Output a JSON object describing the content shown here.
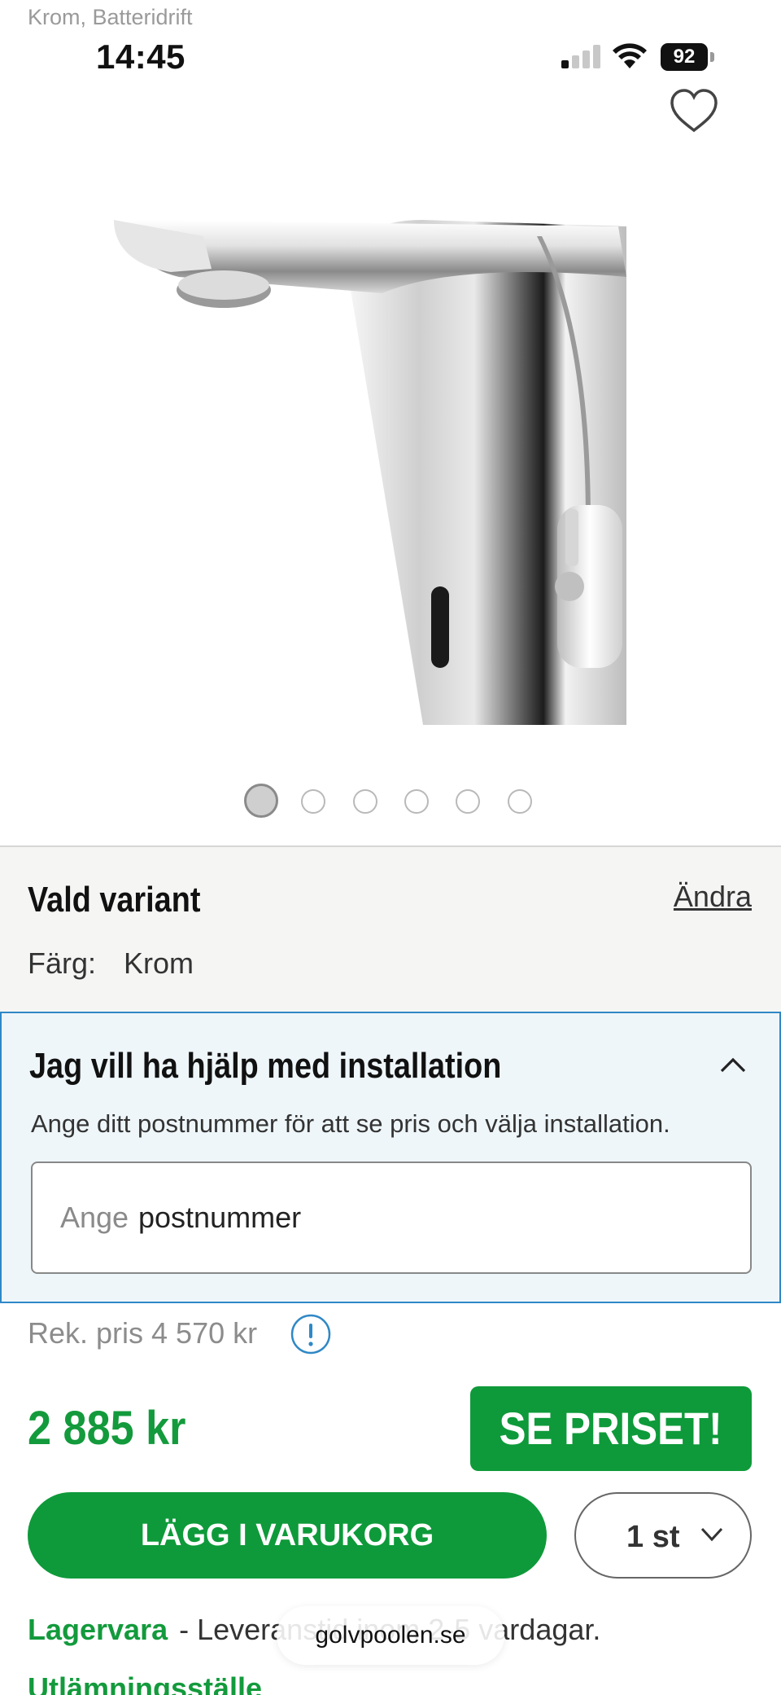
{
  "header": {
    "variant_label": "Krom, Batteridrift"
  },
  "status_bar": {
    "time": "14:45",
    "battery": "92"
  },
  "gallery": {
    "image_count": 6,
    "active_index": 0
  },
  "variant": {
    "title": "Vald variant",
    "change_label": "Ändra",
    "color_label": "Färg:",
    "color_value": "Krom"
  },
  "installation": {
    "title": "Jag vill ha hjälp med installation",
    "description": "Ange ditt postnummer för att se pris och välja installation.",
    "input_placeholder": "Ange",
    "input_value": "postnummer"
  },
  "pricing": {
    "recommended": "Rek. pris 4 570 kr",
    "price": "2 885 kr",
    "see_price_label": "SE PRISET!"
  },
  "cart": {
    "add_label": "LÄGG I VARUKORG",
    "quantity": "1 st"
  },
  "stock": {
    "status": "Lagervara",
    "delivery": "- Leveranstid inom 2-5 vardagar.",
    "pickup_label": "Utlämningsställe"
  },
  "browser": {
    "url": "golvpoolen.se"
  },
  "colors": {
    "brand_green": "#0e9a3a",
    "price_green": "#139a3c",
    "info_blue": "#2f88c6"
  }
}
